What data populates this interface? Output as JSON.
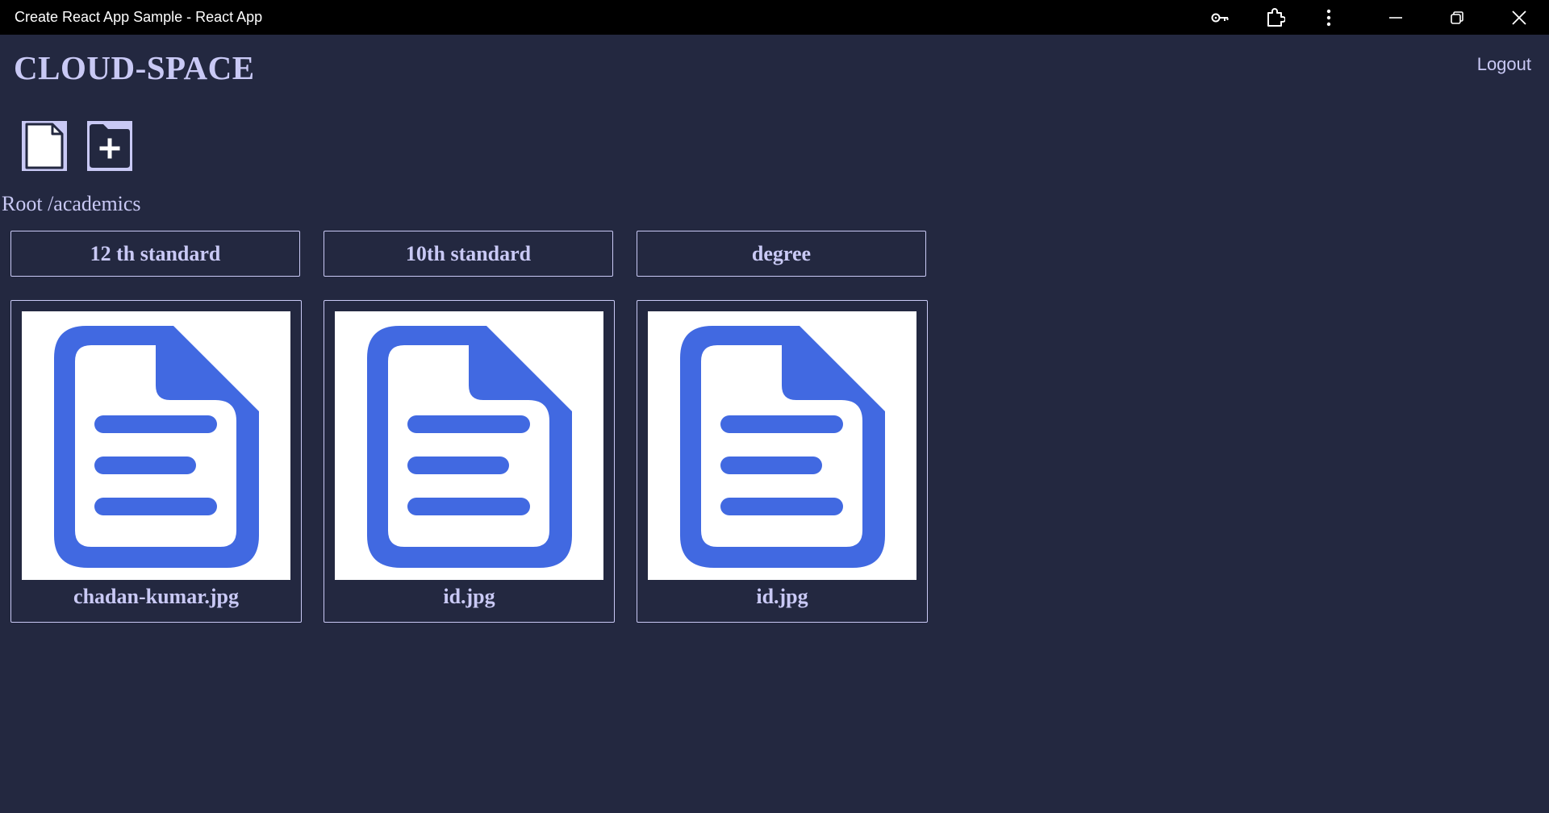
{
  "window": {
    "title": "Create React App Sample - React App",
    "icons": [
      "key-icon",
      "extensions-icon",
      "more-options-icon",
      "minimize-icon",
      "restore-icon",
      "close-icon"
    ]
  },
  "header": {
    "brand": "CLOUD-SPACE",
    "logout_label": "Logout"
  },
  "toolbar": {
    "icons": [
      "upload-file-icon",
      "add-folder-icon"
    ]
  },
  "breadcrumb": {
    "path": "Root /academics"
  },
  "folders": [
    {
      "label": "12 th standard"
    },
    {
      "label": "10th standard"
    },
    {
      "label": "degree"
    }
  ],
  "files": [
    {
      "name": "chadan-kumar.jpg",
      "icon": "document-icon"
    },
    {
      "name": "id.jpg",
      "icon": "document-icon"
    },
    {
      "name": "id.jpg",
      "icon": "document-icon"
    }
  ],
  "colors": {
    "background": "#232840",
    "text": "#c9c9f5",
    "titlebar": "#000000",
    "doc_icon": "#4169e1"
  }
}
